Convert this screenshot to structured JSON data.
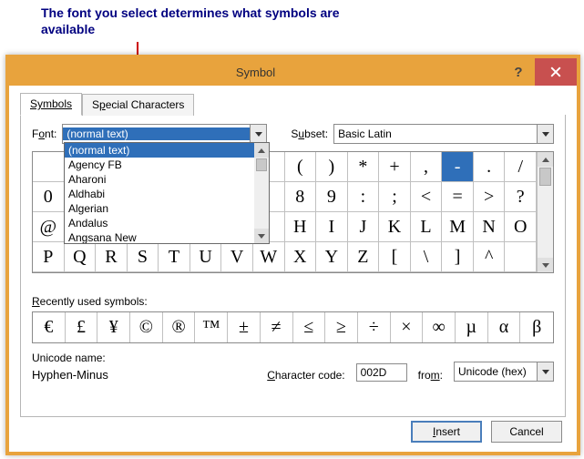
{
  "caption": "The font you select determines what symbols are available",
  "dialog": {
    "title": "Symbol",
    "tabs": {
      "symbols": "Symbols",
      "special": "Special Characters"
    },
    "font_label_pre": "F",
    "font_label_u": "o",
    "font_label_post": "nt:",
    "font_value": "(normal text)",
    "font_options": [
      "(normal text)",
      "Agency FB",
      "Aharoni",
      "Aldhabi",
      "Algerian",
      "Andalus",
      "Angsana New"
    ],
    "subset_label_pre": "S",
    "subset_label_u": "u",
    "subset_label_post": "bset:",
    "subset_value": "Basic Latin",
    "grid_rows": [
      [
        "",
        "",
        "",
        "",
        "",
        "",
        "",
        "",
        "(",
        ")",
        "*",
        "+",
        ",",
        "-",
        ".",
        "/"
      ],
      [
        "0",
        "",
        "",
        "",
        "",
        "",
        "",
        "",
        "8",
        "9",
        ":",
        ";",
        "<",
        "=",
        ">",
        "?"
      ],
      [
        "@",
        "",
        "",
        "",
        "",
        "",
        "",
        "",
        "H",
        "I",
        "J",
        "K",
        "L",
        "M",
        "N",
        "O"
      ],
      [
        "P",
        "Q",
        "R",
        "S",
        "T",
        "U",
        "V",
        "W",
        "X",
        "Y",
        "Z",
        "[",
        "\\",
        "]",
        "^",
        ""
      ]
    ],
    "selected_cell": {
      "row": 0,
      "col": 13
    },
    "recent_label": "Recently used symbols:",
    "recent": [
      "€",
      "£",
      "¥",
      "©",
      "®",
      "™",
      "±",
      "≠",
      "≤",
      "≥",
      "÷",
      "×",
      "∞",
      "µ",
      "α",
      "β"
    ],
    "unicode_name_label": "Unicode name:",
    "unicode_name_value": "Hyphen-Minus",
    "charcode_label_u": "C",
    "charcode_label_post": "haracter code:",
    "charcode_value": "002D",
    "from_label_pre": "fro",
    "from_label_u": "m",
    "from_label_post": ":",
    "from_value": "Unicode (hex)",
    "buttons": {
      "insert": "Insert",
      "cancel": "Cancel"
    }
  }
}
